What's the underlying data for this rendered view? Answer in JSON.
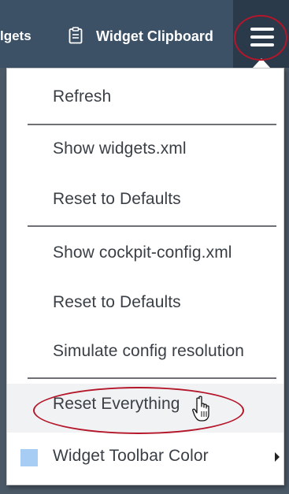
{
  "toolbar": {
    "partial_label": "lgets",
    "clipboard_label": "Widget Clipboard",
    "clipboard_icon": "clipboard-icon",
    "menu_icon": "hamburger-menu-icon"
  },
  "menu": {
    "refresh": "Refresh",
    "show_widgets_xml": "Show widgets.xml",
    "reset_defaults_1": "Reset to Defaults",
    "show_cockpit_config": "Show cockpit-config.xml",
    "reset_defaults_2": "Reset to Defaults",
    "simulate_config": "Simulate config resolution",
    "reset_everything": "Reset Everything",
    "toolbar_color": "Widget Toolbar Color"
  },
  "colors": {
    "toolbar_bg": "#3d5166",
    "annotation_red": "#b4162a",
    "swatch": "#a7cdf5"
  }
}
